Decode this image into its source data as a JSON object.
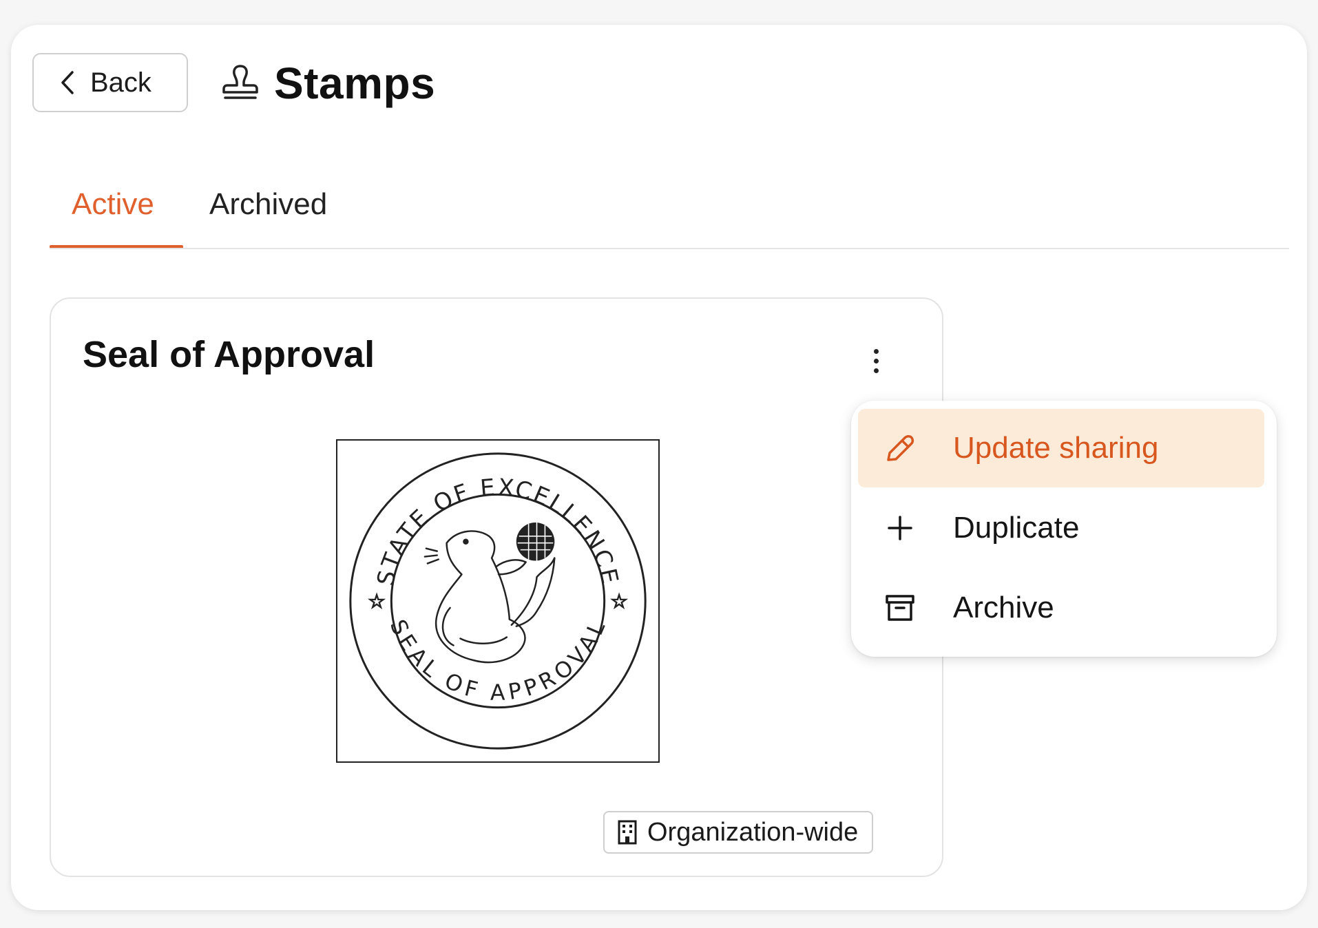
{
  "header": {
    "back_label": "Back",
    "title": "Stamps"
  },
  "tabs": [
    {
      "label": "Active",
      "selected": true
    },
    {
      "label": "Archived",
      "selected": false
    }
  ],
  "card": {
    "title": "Seal of Approval",
    "seal": {
      "top_text": "STATE OF EXCELLENCE",
      "bottom_text": "SEAL OF APPROVAL"
    },
    "sharing_badge": "Organization-wide"
  },
  "menu": {
    "items": [
      {
        "label": "Update sharing",
        "icon": "pencil-icon",
        "highlighted": true
      },
      {
        "label": "Duplicate",
        "icon": "plus-icon",
        "highlighted": false
      },
      {
        "label": "Archive",
        "icon": "archive-box-icon",
        "highlighted": false
      }
    ]
  },
  "colors": {
    "accent": "#e0602d",
    "menu_highlight_bg": "#fdebd9",
    "menu_highlight_text": "#d8571f"
  }
}
